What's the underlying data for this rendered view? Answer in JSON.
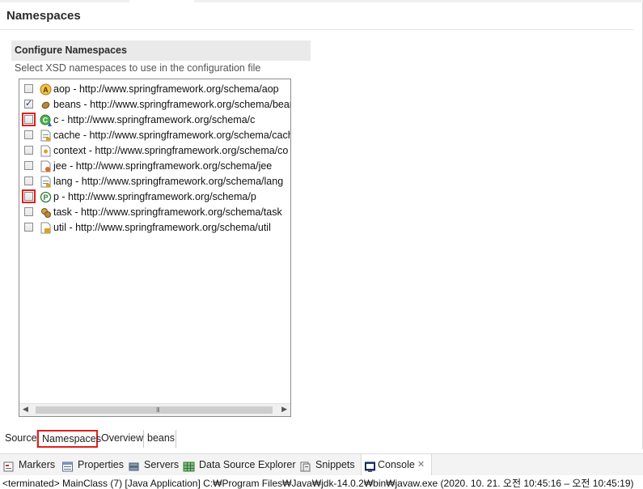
{
  "page": {
    "title": "Namespaces"
  },
  "section": {
    "title": "Configure Namespaces",
    "description": "Select XSD namespaces to use in the configuration file"
  },
  "namespaces": [
    {
      "label": "aop - http://www.springframework.org/schema/aop",
      "checked": false,
      "highlighted": false,
      "icon": "aop-icon"
    },
    {
      "label": "beans - http://www.springframework.org/schema/bean",
      "checked": true,
      "highlighted": false,
      "icon": "bean-icon"
    },
    {
      "label": "c - http://www.springframework.org/schema/c",
      "checked": false,
      "highlighted": true,
      "icon": "c-namespace-icon"
    },
    {
      "label": "cache - http://www.springframework.org/schema/cach",
      "checked": false,
      "highlighted": false,
      "icon": "xsd-file-icon"
    },
    {
      "label": "context - http://www.springframework.org/schema/co",
      "checked": false,
      "highlighted": false,
      "icon": "context-icon"
    },
    {
      "label": "jee - http://www.springframework.org/schema/jee",
      "checked": false,
      "highlighted": false,
      "icon": "jee-icon"
    },
    {
      "label": "lang - http://www.springframework.org/schema/lang",
      "checked": false,
      "highlighted": false,
      "icon": "xsd-file-icon"
    },
    {
      "label": "p - http://www.springframework.org/schema/p",
      "checked": false,
      "highlighted": true,
      "icon": "p-namespace-icon"
    },
    {
      "label": "task - http://www.springframework.org/schema/task",
      "checked": false,
      "highlighted": false,
      "icon": "task-icon"
    },
    {
      "label": "util - http://www.springframework.org/schema/util",
      "checked": false,
      "highlighted": false,
      "icon": "util-icon"
    }
  ],
  "scrollbar": {
    "grip": "III"
  },
  "editor_tabs": [
    {
      "label": "Source",
      "active": false
    },
    {
      "label": "Namespaces",
      "active": true
    },
    {
      "label": "Overview",
      "active": false
    },
    {
      "label": "beans",
      "active": false
    }
  ],
  "views": [
    {
      "label": "Markers",
      "icon": "markers-icon",
      "active": false
    },
    {
      "label": "Properties",
      "icon": "properties-icon",
      "active": false
    },
    {
      "label": "Servers",
      "icon": "servers-icon",
      "active": false
    },
    {
      "label": "Data Source Explorer",
      "icon": "data-source-icon",
      "active": false
    },
    {
      "label": "Snippets",
      "icon": "snippets-icon",
      "active": false
    },
    {
      "label": "Console",
      "icon": "console-icon",
      "active": true
    }
  ],
  "console": {
    "text": "<terminated> MainClass (7) [Java Application] C:₩Program Files₩Java₩jdk-14.0.2₩bin₩javaw.exe  (2020. 10. 21. 오전 10:45:16 – 오전 10:45:19)"
  },
  "colors": {
    "highlight": "#e02020",
    "section_bg": "#eaeaea",
    "views_bg": "#f3f3f3"
  }
}
